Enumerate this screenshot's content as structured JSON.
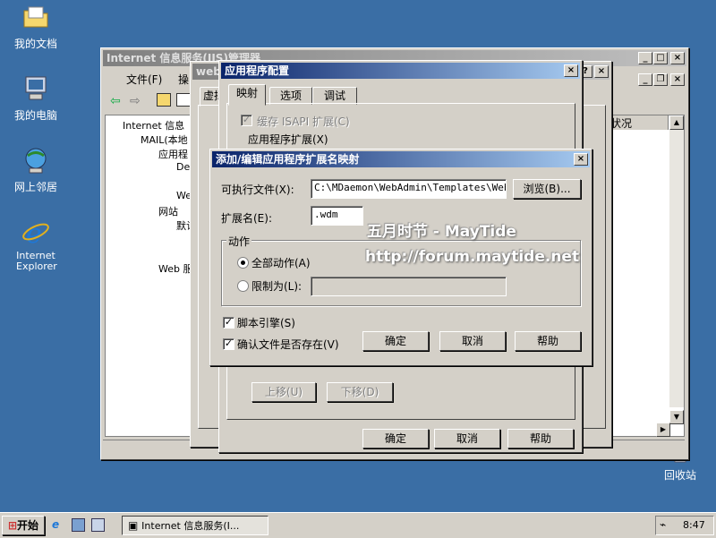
{
  "desktop": {
    "icons": [
      {
        "label": "我的文档",
        "icon": "folder-documents-icon"
      },
      {
        "label": "我的电脑",
        "icon": "computer-icon"
      },
      {
        "label": "网上邻居",
        "icon": "network-icon"
      },
      {
        "label": "Internet Explorer",
        "icon": "ie-icon"
      },
      {
        "label": "回收站",
        "icon": "recycle-bin-icon"
      }
    ]
  },
  "iis_window": {
    "title": "Internet 信息服务(IIS)管理器",
    "menu": [
      "文件(F)",
      "操"
    ],
    "tree": [
      "Internet 信息",
      "MAIL(本地",
      "应用程",
      "Def",
      "Web",
      "网站",
      "默认",
      "Web 服"
    ],
    "column_header": "状况"
  },
  "web_props_window": {
    "title": "web",
    "tab": "虚拟"
  },
  "app_config": {
    "title": "应用程序配置",
    "tabs": [
      "映射",
      "选项",
      "调试"
    ],
    "cache_isapi": "缓存 ISAPI 扩展(C)",
    "app_ext_group": "应用程序扩展(X)",
    "move_up": "上移(U)",
    "move_down": "下移(D)",
    "ok": "确定",
    "cancel": "取消",
    "help": "帮助"
  },
  "add_mapping": {
    "title": "添加/编辑应用程序扩展名映射",
    "exe_label": "可执行文件(X):",
    "exe_value": "C:\\MDaemon\\WebAdmin\\Templates\\WebAdm",
    "browse": "浏览(B)...",
    "ext_label": "扩展名(E):",
    "ext_value": ".wdm",
    "action_group": "动作",
    "all_verbs": "全部动作(A)",
    "limit_to": "限制为(L):",
    "script_engine": "脚本引擎(S)",
    "verify_file": "确认文件是否存在(V)",
    "ok": "确定",
    "cancel": "取消",
    "help": "帮助"
  },
  "watermark": {
    "line1": "五月时节 - MayTide",
    "line2": "http://forum.maytide.net"
  },
  "taskbar": {
    "start": "开始",
    "task": "Internet 信息服务(I...",
    "clock": "8:47"
  }
}
